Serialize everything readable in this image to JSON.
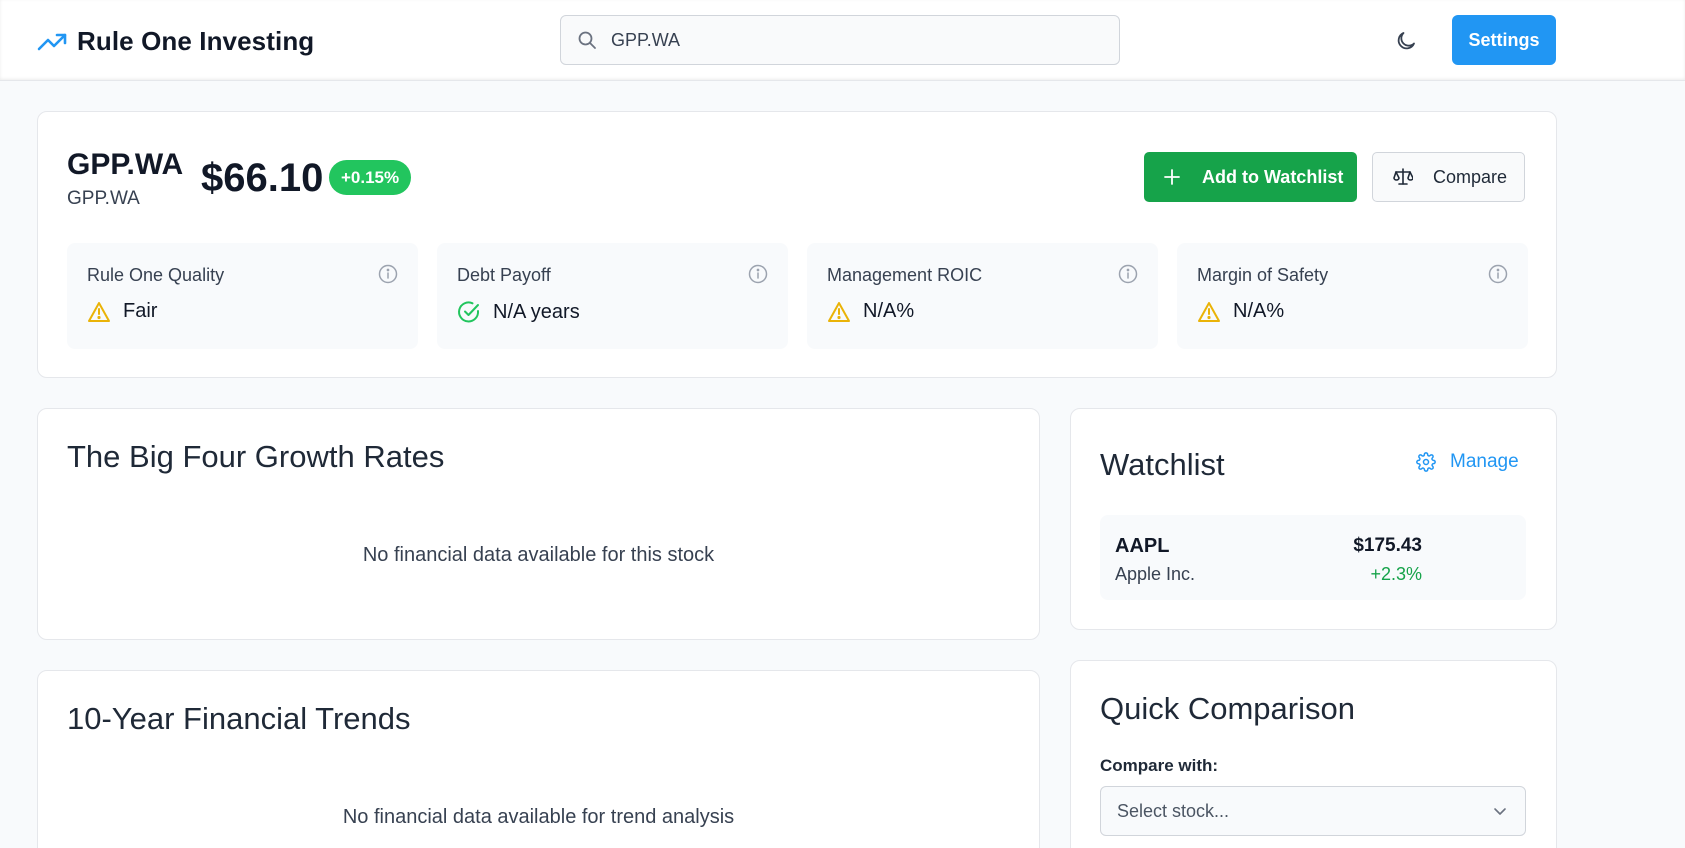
{
  "header": {
    "brand_title": "Rule One Investing",
    "brand_icon": "trending-up-icon",
    "search_value": "GPP.WA",
    "settings_label": "Settings",
    "accent": "#2196f3"
  },
  "stock": {
    "ticker": "GPP.WA",
    "subtitle": "GPP.WA",
    "price": "$66.10",
    "change": "+0.15%",
    "add_label": "Add to Watchlist",
    "compare_label": "Compare"
  },
  "metrics": [
    {
      "label": "Rule One Quality",
      "value": "Fair",
      "icon": "warning-icon"
    },
    {
      "label": "Debt Payoff",
      "value": "N/A years",
      "icon": "check-circle-icon"
    },
    {
      "label": "Management ROIC",
      "value": "N/A%",
      "icon": "warning-icon"
    },
    {
      "label": "Margin of Safety",
      "value": "N/A%",
      "icon": "warning-icon"
    }
  ],
  "big_four": {
    "title": "The Big Four Growth Rates",
    "empty": "No financial data available for this stock"
  },
  "trends": {
    "title": "10-Year Financial Trends",
    "empty": "No financial data available for trend analysis"
  },
  "watchlist": {
    "title": "Watchlist",
    "manage_label": "Manage",
    "items": [
      {
        "symbol": "AAPL",
        "name": "Apple Inc.",
        "price": "$175.43",
        "change": "+2.3%"
      }
    ]
  },
  "quick_comparison": {
    "title": "Quick Comparison",
    "label": "Compare with:",
    "select_placeholder": "Select stock..."
  },
  "colors": {
    "positive": "#22c55e",
    "add_button": "#16a34a",
    "warning": "#eab308"
  }
}
